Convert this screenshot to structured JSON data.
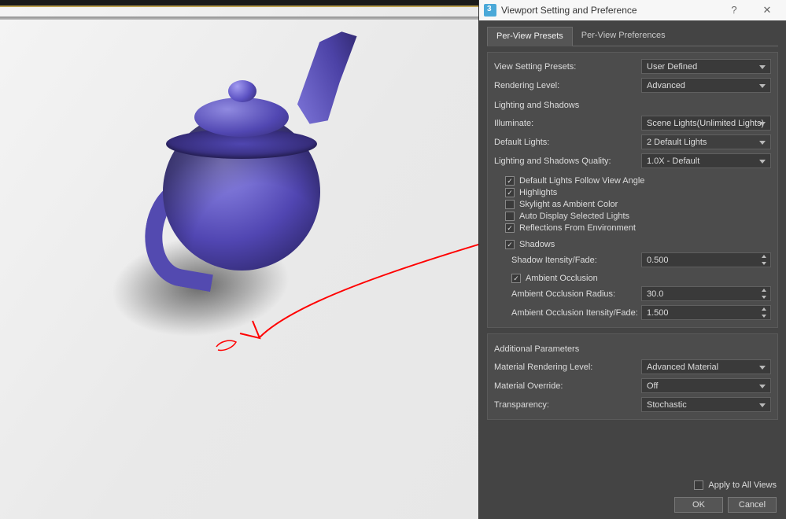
{
  "window": {
    "title": "Viewport Setting and Preference"
  },
  "tabs": {
    "presets": "Per-View Presets",
    "preferences": "Per-View Preferences"
  },
  "rows": {
    "view_setting_presets": {
      "label": "View Setting Presets:",
      "value": "User Defined"
    },
    "rendering_level": {
      "label": "Rendering Level:",
      "value": "Advanced"
    },
    "lighting_shadows_header": "Lighting and Shadows",
    "illuminate": {
      "label": "Illuminate:",
      "value": "Scene Lights(Unlimited Lights)"
    },
    "default_lights": {
      "label": "Default Lights:",
      "value": "2 Default Lights"
    },
    "quality": {
      "label": "Lighting and Shadows Quality:",
      "value": "1.0X - Default"
    }
  },
  "checks": {
    "follow_view": "Default Lights Follow View Angle",
    "highlights": "Highlights",
    "skylight": "Skylight as Ambient Color",
    "auto_display": "Auto Display Selected Lights",
    "reflections": "Reflections From Environment",
    "shadows": "Shadows",
    "ao": "Ambient Occlusion"
  },
  "shadow": {
    "label": "Shadow Itensity/Fade:",
    "value": "0.500"
  },
  "ao": {
    "radius_label": "Ambient Occlusion Radius:",
    "radius_value": "30.0",
    "fade_label": "Ambient Occlusion Itensity/Fade:",
    "fade_value": "1.500"
  },
  "additional": {
    "header": "Additional Parameters",
    "material_level": {
      "label": "Material Rendering Level:",
      "value": "Advanced Material"
    },
    "material_override": {
      "label": "Material Override:",
      "value": "Off"
    },
    "transparency": {
      "label": "Transparency:",
      "value": "Stochastic"
    }
  },
  "footer": {
    "apply_all": "Apply to All Views",
    "ok": "OK",
    "cancel": "Cancel"
  }
}
